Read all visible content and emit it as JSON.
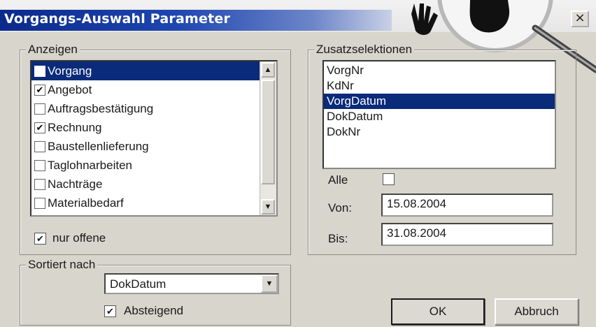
{
  "window": {
    "title": "Vorgangs-Auswahl Parameter",
    "close_label": "×"
  },
  "anzeigen": {
    "legend": "Anzeigen",
    "items": [
      {
        "label": "Vorgang",
        "checked": false,
        "mark": ""
      },
      {
        "label": "Angebot",
        "checked": true,
        "mark": "✔"
      },
      {
        "label": "Auftragsbestätigung",
        "checked": false,
        "mark": ""
      },
      {
        "label": "Rechnung",
        "checked": true,
        "mark": "✔"
      },
      {
        "label": "Baustellenlieferung",
        "checked": false,
        "mark": ""
      },
      {
        "label": "Taglohnarbeiten",
        "checked": false,
        "mark": ""
      },
      {
        "label": "Nachträge",
        "checked": false,
        "mark": ""
      },
      {
        "label": "Materialbedarf",
        "checked": false,
        "mark": ""
      }
    ],
    "selected_index": 0,
    "nur_offene": {
      "label": "nur offene",
      "checked": true,
      "mark": "✔"
    }
  },
  "sortiert": {
    "legend": "Sortiert nach",
    "value": "DokDatum",
    "absteigend": {
      "label": "Absteigend",
      "checked": true,
      "mark": "✔"
    }
  },
  "zusatz": {
    "legend": "Zusatzselektionen",
    "items": [
      "VorgNr",
      "KdNr",
      "VorgDatum",
      "DokDatum",
      "DokNr"
    ],
    "selected_index": 2,
    "alle_label": "Alle",
    "von_label": "Von:",
    "von_value": "15.08.2004",
    "bis_label": "Bis:",
    "bis_value": "31.08.2004"
  },
  "buttons": {
    "ok": "OK",
    "cancel": "Abbruch"
  },
  "icons": {
    "scroll_up": "▲",
    "scroll_down": "▼",
    "combo_arrow": "▼"
  }
}
